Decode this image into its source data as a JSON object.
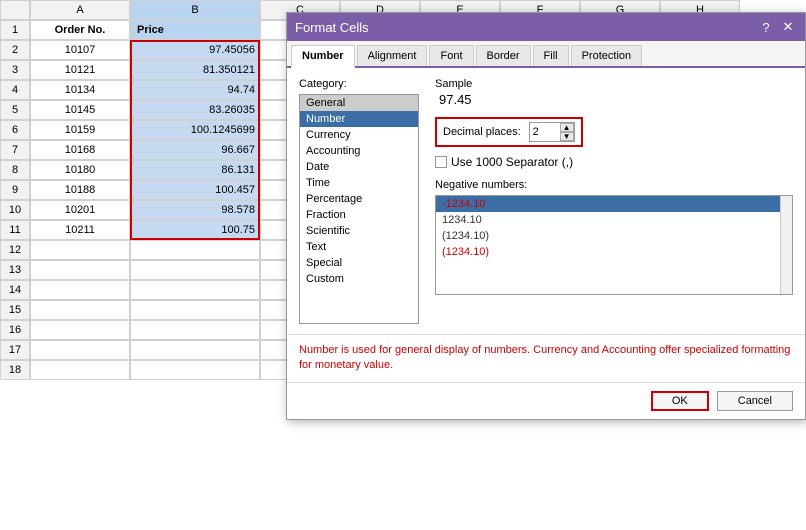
{
  "spreadsheet": {
    "col_headers": [
      "",
      "A",
      "B"
    ],
    "rows": [
      {
        "num": "1",
        "a": "Order No.",
        "b": "Price",
        "is_header": true
      },
      {
        "num": "2",
        "a": "10107",
        "b": "97.45056"
      },
      {
        "num": "3",
        "a": "10121",
        "b": "81.350121"
      },
      {
        "num": "4",
        "a": "10134",
        "b": "94.74"
      },
      {
        "num": "5",
        "a": "10145",
        "b": "83.26035"
      },
      {
        "num": "6",
        "a": "10159",
        "b": "100.1245699"
      },
      {
        "num": "7",
        "a": "10168",
        "b": "96.667"
      },
      {
        "num": "8",
        "a": "10180",
        "b": "86.131"
      },
      {
        "num": "9",
        "a": "10188",
        "b": "100.457"
      },
      {
        "num": "10",
        "a": "10201",
        "b": "98.578"
      },
      {
        "num": "11",
        "a": "10211",
        "b": "100.75"
      },
      {
        "num": "12",
        "a": "",
        "b": ""
      },
      {
        "num": "13",
        "a": "",
        "b": ""
      },
      {
        "num": "14",
        "a": "",
        "b": ""
      },
      {
        "num": "15",
        "a": "",
        "b": ""
      },
      {
        "num": "16",
        "a": "",
        "b": ""
      },
      {
        "num": "17",
        "a": "",
        "b": ""
      },
      {
        "num": "18",
        "a": "",
        "b": ""
      }
    ]
  },
  "dialog": {
    "title": "Format Cells",
    "close_label": "✕",
    "help_label": "?",
    "tabs": [
      {
        "label": "Number",
        "active": true
      },
      {
        "label": "Alignment",
        "active": false
      },
      {
        "label": "Font",
        "active": false
      },
      {
        "label": "Border",
        "active": false
      },
      {
        "label": "Fill",
        "active": false
      },
      {
        "label": "Protection",
        "active": false
      }
    ],
    "category": {
      "label": "Category:",
      "items": [
        {
          "label": "General",
          "type": "general"
        },
        {
          "label": "Number",
          "selected": true
        },
        {
          "label": "Currency"
        },
        {
          "label": "Accounting"
        },
        {
          "label": "Date"
        },
        {
          "label": "Time"
        },
        {
          "label": "Percentage"
        },
        {
          "label": "Fraction"
        },
        {
          "label": "Scientific"
        },
        {
          "label": "Text"
        },
        {
          "label": "Special"
        },
        {
          "label": "Custom"
        }
      ]
    },
    "sample": {
      "label": "Sample",
      "value": "97.45"
    },
    "decimal": {
      "label": "Decimal places:",
      "value": "2"
    },
    "separator": {
      "label": "Use 1000 Separator (,)"
    },
    "negative": {
      "label": "Negative numbers:",
      "items": [
        {
          "label": "-1234.10",
          "type": "red-selected"
        },
        {
          "label": "1234.10",
          "type": "black"
        },
        {
          "label": "(1234.10)",
          "type": "black-paren"
        },
        {
          "label": "(1234.10)",
          "type": "red-paren"
        }
      ]
    },
    "description": "Number is used for general display of numbers.  Currency and Accounting offer specialized formatting for monetary value.",
    "buttons": {
      "ok": "OK",
      "cancel": "Cancel"
    }
  }
}
